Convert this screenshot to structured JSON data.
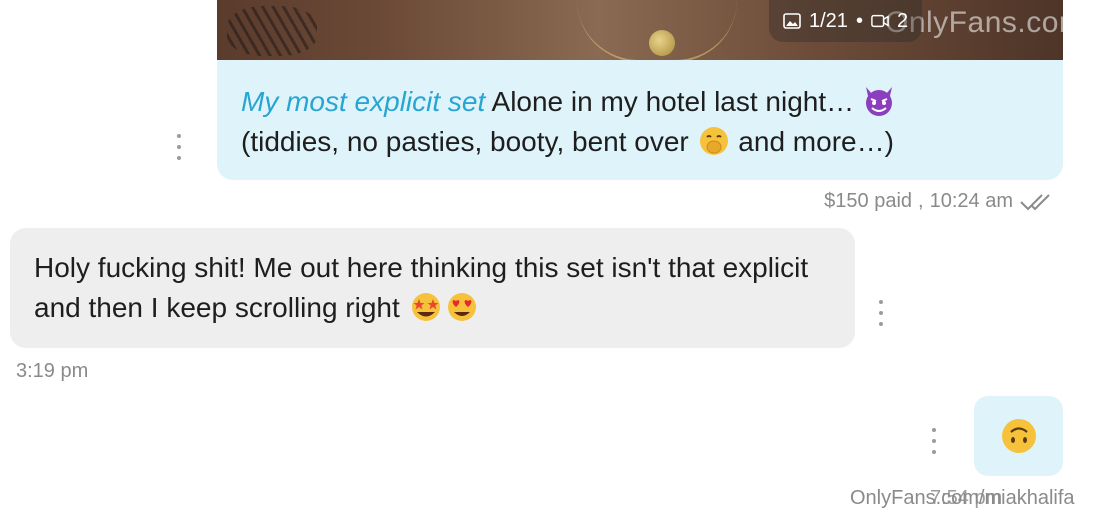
{
  "media_preview": {
    "photo_count": "1/21",
    "separator": "•",
    "video_count": "2",
    "watermark": "OnlyFans.com/miakhalifa"
  },
  "outgoing_message": {
    "highlight": "My most explicit set",
    "text_part1": " Alone in my hotel last night… ",
    "emoji1": "smiling-devil-emoji",
    "text_part2": "(tiddies, no pasties, booty, bent over ",
    "emoji2": "face-with-hand-over-mouth-emoji",
    "text_part3": " and more…)",
    "price_status": "$150 paid",
    "sep": " , ",
    "time": "10:24 am"
  },
  "incoming_message": {
    "text": "Holy fucking shit! Me out here thinking this set isn't that explicit and then I keep scrolling right ",
    "emojis": [
      "star-struck-emoji",
      "heart-eyes-emoji"
    ],
    "time": "3:19 pm"
  },
  "outgoing_small": {
    "emoji": "upside-down-face-emoji",
    "time": "7:54 pm"
  },
  "footer_watermark": "OnlyFans.com/miakhalifa",
  "colors": {
    "outgoing_bubble": "#dff3fa",
    "incoming_bubble": "#eeeeee",
    "accent": "#27a5d3",
    "meta_text": "#8a8a8a"
  }
}
